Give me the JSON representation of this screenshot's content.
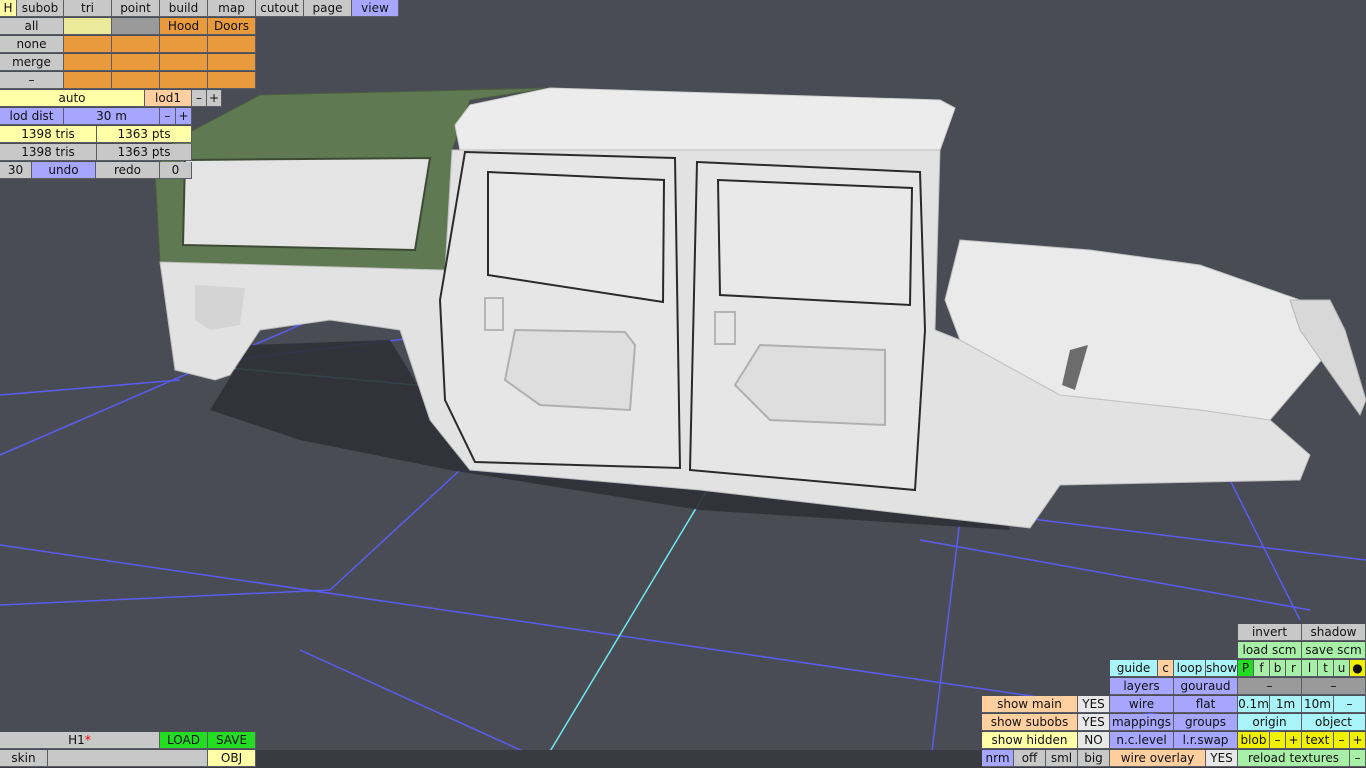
{
  "toolbar": {
    "h": "H",
    "tabs": [
      "subob",
      "tri",
      "point",
      "build",
      "map",
      "cutout",
      "page",
      "view"
    ],
    "active_tab": "view"
  },
  "select": {
    "all": "all",
    "none": "none",
    "merge": "merge",
    "minus": "–",
    "group_hood": "Hood",
    "group_doors": "Doors"
  },
  "lod": {
    "auto": "auto",
    "lod1": "lod1",
    "minus": "–",
    "plus": "+",
    "lod_dist_label": "lod dist",
    "lod_dist_value": "30 m"
  },
  "stats": {
    "row1_tris": "1398 tris",
    "row1_pts": "1363 pts",
    "row2_tris": "1398 tris",
    "row2_pts": "1363 pts"
  },
  "history": {
    "count": "30",
    "undo": "undo",
    "redo": "redo",
    "redo_count": "0"
  },
  "file": {
    "name": "H1",
    "modified_mark": "*",
    "load": "LOAD",
    "save": "SAVE",
    "skin_label": "skin",
    "skin_value": "",
    "obj": "OBJ"
  },
  "view_panel": {
    "invert": "invert",
    "shadow": "shadow",
    "load_scm": "load scm",
    "save_scm": "save scm",
    "guide": "guide",
    "c": "c",
    "loop": "loop",
    "show": "show",
    "flags": [
      "P",
      "f",
      "b",
      "r",
      "l",
      "t",
      "u",
      "●"
    ],
    "layers": "layers",
    "gouraud": "gouraud",
    "dash1": "–",
    "dash2": "–",
    "show_main": "show main",
    "show_main_val": "YES",
    "wire": "wire",
    "flat": "flat",
    "scale_01": "0.1m",
    "scale_1": "1m",
    "scale_10": "10m",
    "scale_minus": "–",
    "show_subobs": "show subobs",
    "show_subobs_val": "YES",
    "mappings": "mappings",
    "groups": "groups",
    "origin": "origin",
    "object": "object",
    "show_hidden": "show hidden",
    "show_hidden_val": "NO",
    "nc_level": "n.c.level",
    "lr_swap": "l.r.swap",
    "blob": "blob",
    "blob_minus": "–",
    "blob_plus": "+",
    "text": "text",
    "text_minus": "–",
    "text_plus": "+",
    "nrm": "nrm",
    "off": "off",
    "sml": "sml",
    "big": "big",
    "wire_overlay": "wire overlay",
    "wire_overlay_val": "YES",
    "reload_textures": "reload textures",
    "reload_minus": "–"
  },
  "colors": {
    "background": "#4a4c55",
    "grid_blue": "#5a5cf0",
    "grid_cyan": "#6ee8ee",
    "hardtop_green": "#5f7a52",
    "body_white": "#e6e6e6"
  }
}
